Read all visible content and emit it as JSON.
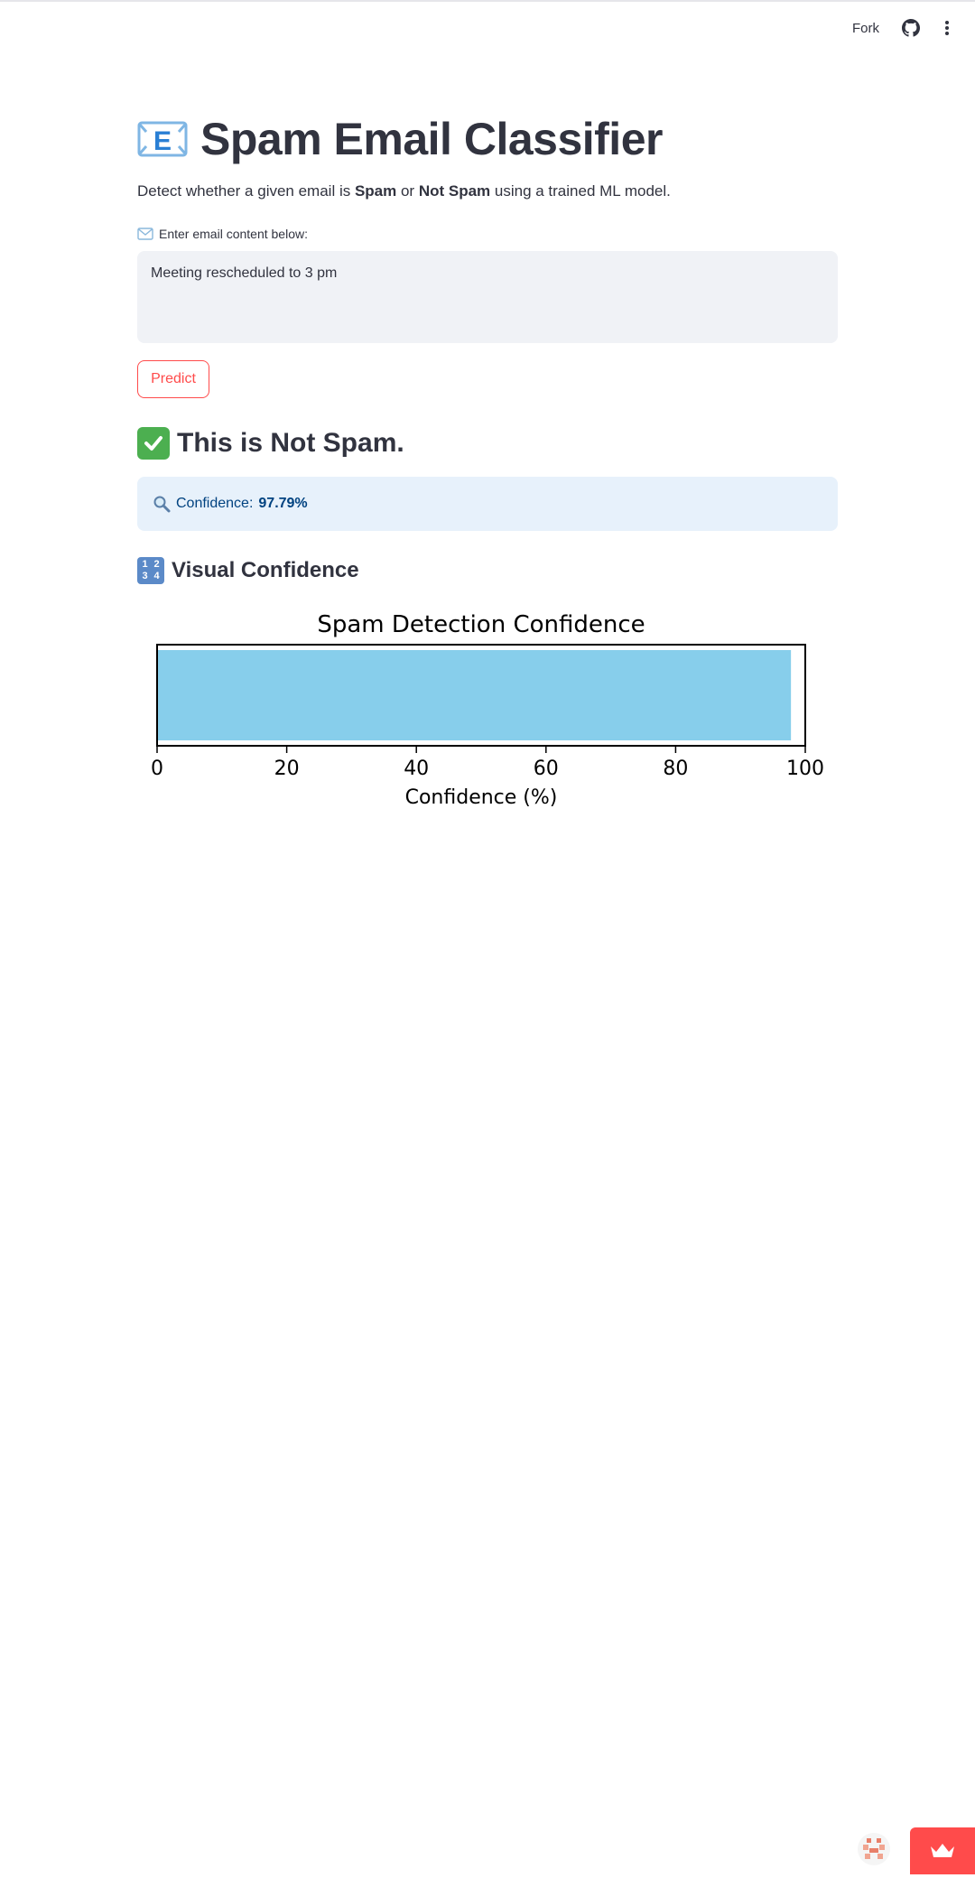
{
  "toolbar": {
    "fork_label": "Fork",
    "github_icon": "github-icon",
    "menu_icon": "kebab-menu-icon"
  },
  "header": {
    "title": "Spam Email Classifier",
    "icon": "envelope-e-icon"
  },
  "description": {
    "prefix": "Detect whether a given email is ",
    "spam": "Spam",
    "middle": " or ",
    "not_spam": "Not Spam",
    "suffix": " using a trained ML model."
  },
  "email_input": {
    "label": "Enter email content below:",
    "value": "Meeting rescheduled to 3 pm"
  },
  "predict_button": {
    "label": "Predict"
  },
  "result": {
    "text": "This is Not Spam."
  },
  "confidence_box": {
    "prefix": "Confidence: ",
    "value": "97.79%"
  },
  "visual_section": {
    "title": "Visual Confidence"
  },
  "colors": {
    "accent": "#ff4b4b",
    "info_bg": "#e7f1fb",
    "info_text": "#004280",
    "bar": "#87ceeb"
  },
  "chart_data": {
    "type": "bar",
    "orientation": "horizontal",
    "title": "Spam Detection Confidence",
    "xlabel": "Confidence (%)",
    "ylabel": "",
    "values": [
      97.79
    ],
    "xlim": [
      0,
      100
    ],
    "xticks": [
      "0",
      "20",
      "40",
      "60",
      "80",
      "100"
    ],
    "grid": false
  }
}
